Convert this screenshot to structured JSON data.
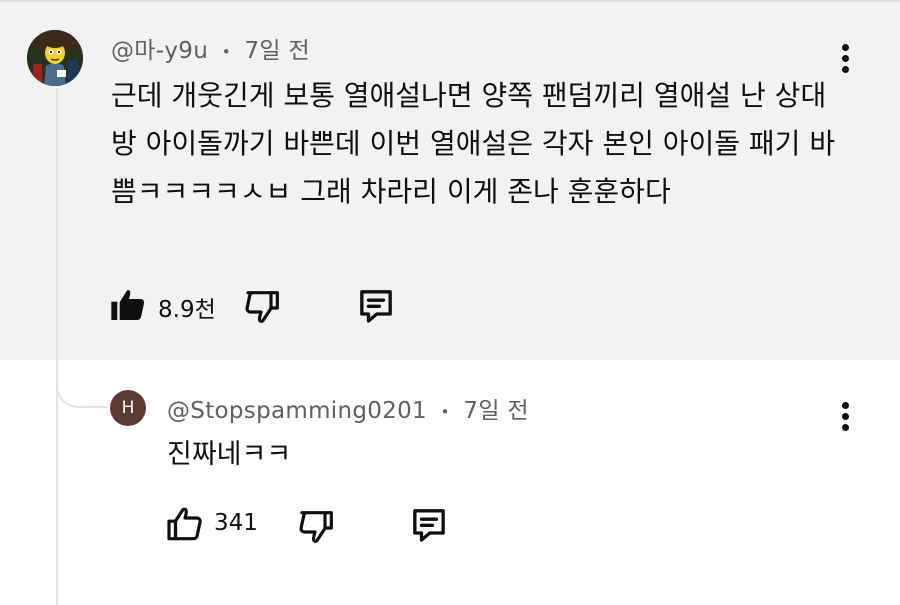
{
  "comment": {
    "author": "@마-y9u",
    "separator": "•",
    "time": "7일 전",
    "text": "근데 개웃긴게 보통 열애설나면 양쪽 팬덤끼리 열애설 난 상대방 아이돌까기 바쁜데 이번 열애설은 각자 본인 아이돌 패기 바쁨ㅋㅋㅋㅋㅅㅂ 그래 차라리 이게 존나 훈훈하다",
    "like_count": "8.9천",
    "like_icon": "thumbs-up-filled-icon",
    "dislike_icon": "thumbs-down-outline-icon",
    "reply_icon": "comment-reply-icon",
    "menu_icon": "more-vertical-icon"
  },
  "reply": {
    "avatar_letter": "H",
    "author": "@Stopspamming0201",
    "separator": "•",
    "time": "7일 전",
    "text": "진짜네ㅋㅋ",
    "like_count": "341",
    "like_icon": "thumbs-up-outline-icon",
    "dislike_icon": "thumbs-down-outline-icon",
    "reply_icon": "comment-reply-icon",
    "menu_icon": "more-vertical-icon"
  },
  "colors": {
    "main_background": "#f2f2f2",
    "meta_text": "#606060",
    "reply_avatar": "#5c3b30"
  }
}
